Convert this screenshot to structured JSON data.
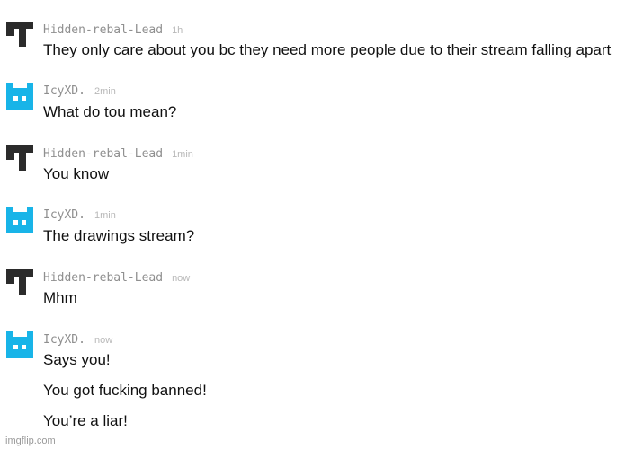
{
  "colors": {
    "dark_avatar": "#2b2b2b",
    "blue_avatar": "#18b4e8"
  },
  "messages": [
    {
      "avatar": "dark-castle-icon",
      "user": "Hidden-rebal-Lead",
      "time": "1h",
      "lines": [
        "They only care about you bc they need more people due to their stream falling apart"
      ]
    },
    {
      "avatar": "blue-cat-icon",
      "user": "IcyXD.",
      "time": "2min",
      "lines": [
        "What do tou mean?"
      ]
    },
    {
      "avatar": "dark-castle-icon",
      "user": "Hidden-rebal-Lead",
      "time": "1min",
      "lines": [
        "You know"
      ]
    },
    {
      "avatar": "blue-cat-icon",
      "user": "IcyXD.",
      "time": "1min",
      "lines": [
        "The drawings stream?"
      ]
    },
    {
      "avatar": "dark-castle-icon",
      "user": "Hidden-rebal-Lead",
      "time": "now",
      "lines": [
        "Mhm"
      ]
    },
    {
      "avatar": "blue-cat-icon",
      "user": "IcyXD.",
      "time": "now",
      "lines": [
        "Says you!",
        "You got fucking banned!",
        "You’re a liar!"
      ]
    }
  ],
  "watermark": "imgflip.com"
}
